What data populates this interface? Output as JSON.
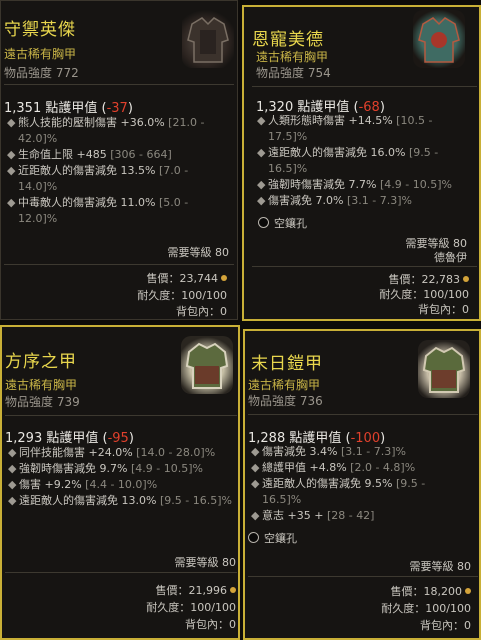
{
  "items": [
    {
      "name": "守禦英傑",
      "type": "遠古稀有胸甲",
      "power": "物品強度 772",
      "armor_value": "1,351",
      "armor_label": "點護甲值",
      "armor_delta": "-37",
      "affixes": [
        {
          "text": "熊人技能的壓制傷害 +36.0%",
          "range": "[21.0 - 42.0]%"
        },
        {
          "text": "生命值上限 +485",
          "range": "[306 - 664]"
        },
        {
          "text": "近距敵人的傷害減免 13.5%",
          "range": "[7.0 - 14.0]%"
        },
        {
          "text": "中毒敵人的傷害減免 11.0%",
          "range": "[5.0 - 12.0]%"
        }
      ],
      "required_level": "需要等級 80",
      "sell": "售價：23,744",
      "durability": "耐久度：100/100",
      "in_bag": "背包內：0"
    },
    {
      "name": "恩寵美德",
      "type": "遠古稀有胸甲",
      "power": "物品強度 754",
      "armor_value": "1,320",
      "armor_label": "點護甲值",
      "armor_delta": "-68",
      "affixes": [
        {
          "text": "人類形態時傷害 +14.5%",
          "range": "[10.5 - 17.5]%"
        },
        {
          "text": "遠距敵人的傷害減免 16.0%",
          "range": "[9.5 - 16.5]%"
        },
        {
          "text": "強韌時傷害減免 7.7%",
          "range": "[4.9 - 10.5]%"
        },
        {
          "text": "傷害減免 7.0%",
          "range": "[3.1 - 7.3]%"
        }
      ],
      "socket": "空鑲孔",
      "required_level": "需要等級 80",
      "class": "德魯伊",
      "sell": "售價：22,783",
      "durability": "耐久度：100/100",
      "in_bag": "背包內：0"
    },
    {
      "name": "方序之甲",
      "type": "遠古稀有胸甲",
      "power": "物品強度 739",
      "armor_value": "1,293",
      "armor_label": "點護甲值",
      "armor_delta": "-95",
      "affixes": [
        {
          "text": "同伴技能傷害 +24.0%",
          "range": "[14.0 - 28.0]%"
        },
        {
          "text": "強韌時傷害減免 9.7%",
          "range": "[4.9 - 10.5]%"
        },
        {
          "text": "傷害 +9.2%",
          "range": "[4.4 - 10.0]%"
        },
        {
          "text": "遠距敵人的傷害減免 13.0%",
          "range": "[9.5 - 16.5]%"
        }
      ],
      "required_level": "需要等級 80",
      "sell": "售價：21,996",
      "durability": "耐久度：100/100",
      "in_bag": "背包內：0"
    },
    {
      "name": "末日鎧甲",
      "type": "遠古稀有胸甲",
      "power": "物品強度 736",
      "armor_value": "1,288",
      "armor_label": "點護甲值",
      "armor_delta": "-100",
      "affixes": [
        {
          "text": "傷害減免 3.4%",
          "range": "[3.1 - 7.3]%"
        },
        {
          "text": "總護甲值 +4.8%",
          "range": "[2.0 - 4.8]%"
        },
        {
          "text": "遠距敵人的傷害減免 9.5%",
          "range": "[9.5 - 16.5]%"
        },
        {
          "text": "意志 +35 +",
          "range": "[28 - 42]"
        }
      ],
      "socket": "空鑲孔",
      "required_level": "需要等級 80",
      "sell": "售價：18,200",
      "durability": "耐久度：100/100",
      "in_bag": "背包內：0"
    }
  ],
  "colors": {
    "title": "#e8d64d",
    "type": "#c8b447",
    "delta_negative": "#e0402c",
    "selected_border": "#c9b037",
    "panel_bg": "#161412"
  },
  "icons": [
    "chest-armor-icon",
    "socket-icon",
    "gold-coin-icon",
    "bullet-icon"
  ]
}
